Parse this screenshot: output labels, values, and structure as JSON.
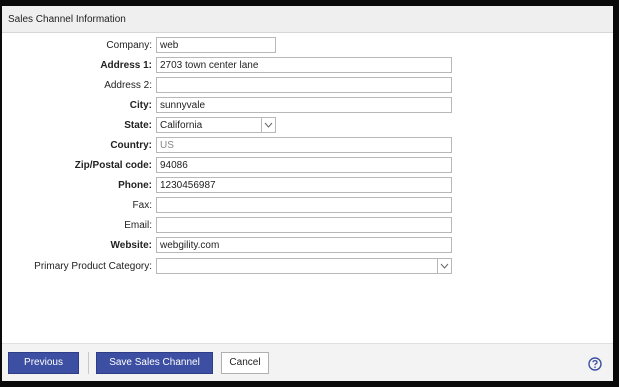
{
  "header": {
    "title": "Sales Channel Information"
  },
  "form": {
    "company": {
      "label": "Company:",
      "value": "web"
    },
    "address1": {
      "label": "Address 1:",
      "value": "2703 town center lane"
    },
    "address2": {
      "label": "Address 2:",
      "value": ""
    },
    "city": {
      "label": "City:",
      "value": "sunnyvale"
    },
    "state": {
      "label": "State:",
      "value": "California"
    },
    "country": {
      "label": "Country:",
      "value": "US"
    },
    "zip": {
      "label": "Zip/Postal code:",
      "value": "94086"
    },
    "phone": {
      "label": "Phone:",
      "value": "1230456987"
    },
    "fax": {
      "label": "Fax:",
      "value": ""
    },
    "email": {
      "label": "Email:",
      "value": ""
    },
    "website": {
      "label": "Website:",
      "value": "webgility.com"
    },
    "category": {
      "label": "Primary Product Category:",
      "value": ""
    }
  },
  "footer": {
    "previous_label": "Previous",
    "save_label": "Save Sales Channel",
    "cancel_label": "Cancel"
  },
  "icons": {
    "help": "help-circle-icon",
    "dropdown": "chevron-down-icon"
  },
  "colors": {
    "primary_button": "#3d4fa3",
    "help_icon": "#3d4fa3"
  }
}
